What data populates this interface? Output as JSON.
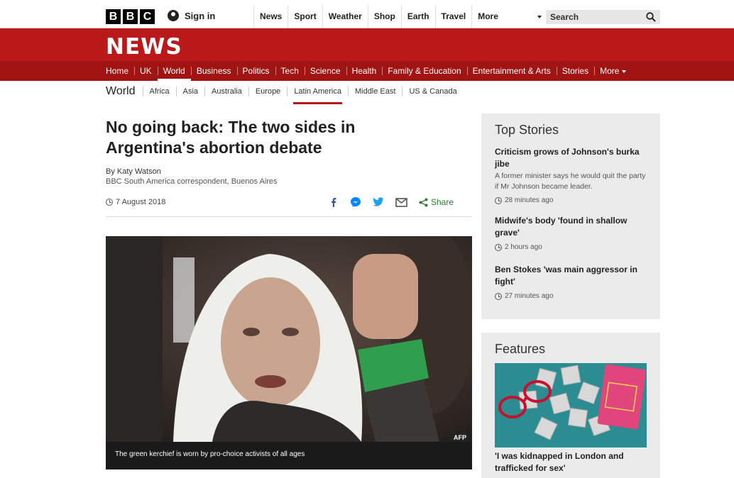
{
  "brand": {
    "logo_letters": [
      "B",
      "B",
      "C"
    ],
    "wordmark": "NEWS"
  },
  "topbar": {
    "signin_label": "Sign in",
    "nav": [
      "News",
      "Sport",
      "Weather",
      "Shop",
      "Earth",
      "Travel",
      "More"
    ],
    "search_placeholder": "Search"
  },
  "main_nav": {
    "items": [
      "Home",
      "UK",
      "World",
      "Business",
      "Politics",
      "Tech",
      "Science",
      "Health",
      "Family & Education",
      "Entertainment & Arts",
      "Stories",
      "More"
    ],
    "active": "World"
  },
  "section_nav": {
    "section": "World",
    "items": [
      "Africa",
      "Asia",
      "Australia",
      "Europe",
      "Latin America",
      "Middle East",
      "US & Canada"
    ],
    "active": "Latin America"
  },
  "article": {
    "headline": "No going back: The two sides in Argentina's abortion debate",
    "byline": "By Katy Watson",
    "role": "BBC South America correspondent, Buenos Aires",
    "date": "7 August 2018",
    "share_label": "Share",
    "image_credit": "AFP",
    "image_caption": "The green kerchief is worn by pro-choice activists of all ages"
  },
  "top_stories": {
    "title": "Top Stories",
    "items": [
      {
        "headline": "Criticism grows of Johnson's burka jibe",
        "summary": "A former minister says he would quit the party if Mr Johnson became leader.",
        "time": "28 minutes ago"
      },
      {
        "headline": "Midwife's body 'found in shallow grave'",
        "summary": "",
        "time": "2 hours ago"
      },
      {
        "headline": "Ben Stokes 'was main aggressor in fight'",
        "summary": "",
        "time": "27 minutes ago"
      }
    ]
  },
  "features": {
    "title": "Features",
    "item_headline": "'I was kidnapped in London and trafficked for sex'"
  },
  "colors": {
    "brand_red": "#bb1919",
    "nav_red": "#a01414",
    "panel_grey": "#ebebeb",
    "share_green": "#2e7d32"
  }
}
